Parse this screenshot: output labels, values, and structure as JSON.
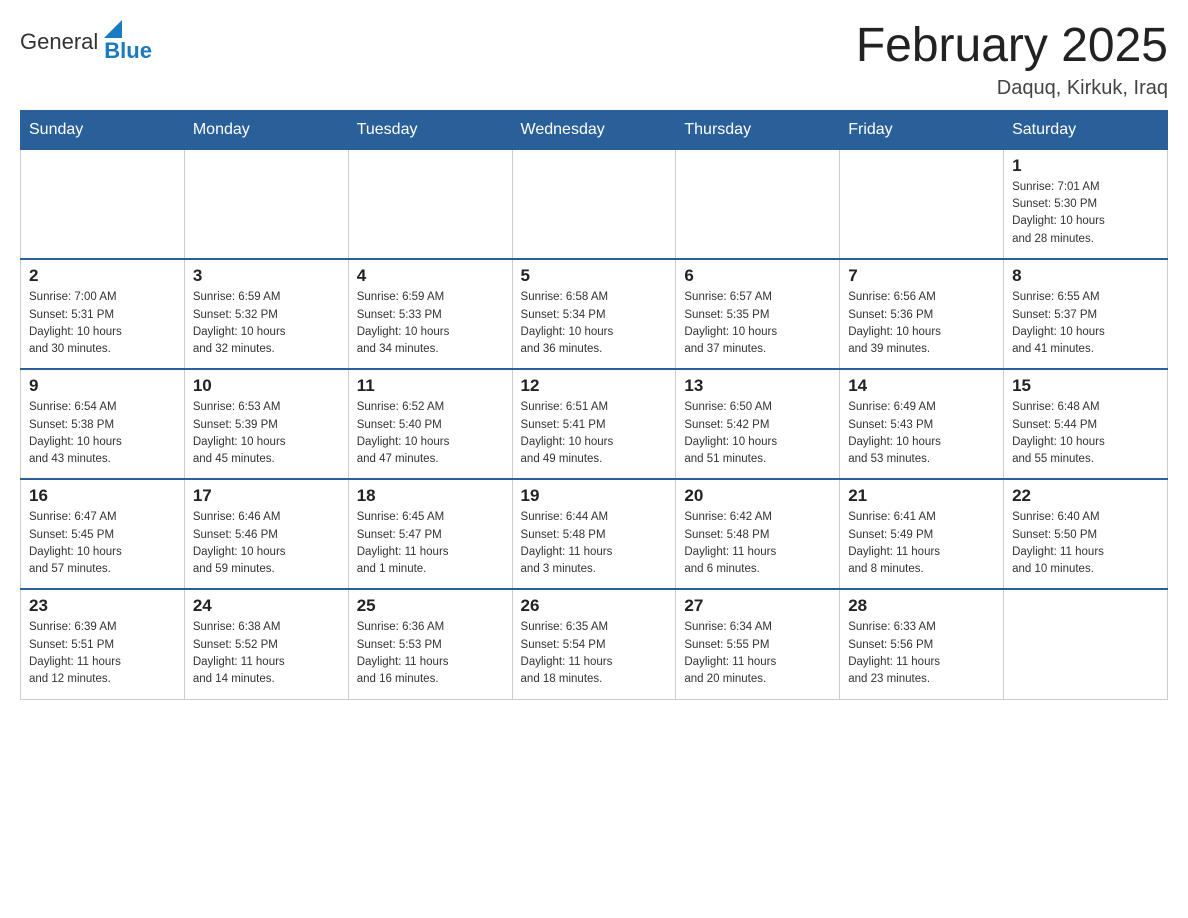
{
  "header": {
    "logo": {
      "general": "General",
      "blue": "Blue"
    },
    "title": "February 2025",
    "location": "Daquq, Kirkuk, Iraq"
  },
  "days_of_week": [
    "Sunday",
    "Monday",
    "Tuesday",
    "Wednesday",
    "Thursday",
    "Friday",
    "Saturday"
  ],
  "weeks": [
    [
      {
        "day": "",
        "info": ""
      },
      {
        "day": "",
        "info": ""
      },
      {
        "day": "",
        "info": ""
      },
      {
        "day": "",
        "info": ""
      },
      {
        "day": "",
        "info": ""
      },
      {
        "day": "",
        "info": ""
      },
      {
        "day": "1",
        "info": "Sunrise: 7:01 AM\nSunset: 5:30 PM\nDaylight: 10 hours\nand 28 minutes."
      }
    ],
    [
      {
        "day": "2",
        "info": "Sunrise: 7:00 AM\nSunset: 5:31 PM\nDaylight: 10 hours\nand 30 minutes."
      },
      {
        "day": "3",
        "info": "Sunrise: 6:59 AM\nSunset: 5:32 PM\nDaylight: 10 hours\nand 32 minutes."
      },
      {
        "day": "4",
        "info": "Sunrise: 6:59 AM\nSunset: 5:33 PM\nDaylight: 10 hours\nand 34 minutes."
      },
      {
        "day": "5",
        "info": "Sunrise: 6:58 AM\nSunset: 5:34 PM\nDaylight: 10 hours\nand 36 minutes."
      },
      {
        "day": "6",
        "info": "Sunrise: 6:57 AM\nSunset: 5:35 PM\nDaylight: 10 hours\nand 37 minutes."
      },
      {
        "day": "7",
        "info": "Sunrise: 6:56 AM\nSunset: 5:36 PM\nDaylight: 10 hours\nand 39 minutes."
      },
      {
        "day": "8",
        "info": "Sunrise: 6:55 AM\nSunset: 5:37 PM\nDaylight: 10 hours\nand 41 minutes."
      }
    ],
    [
      {
        "day": "9",
        "info": "Sunrise: 6:54 AM\nSunset: 5:38 PM\nDaylight: 10 hours\nand 43 minutes."
      },
      {
        "day": "10",
        "info": "Sunrise: 6:53 AM\nSunset: 5:39 PM\nDaylight: 10 hours\nand 45 minutes."
      },
      {
        "day": "11",
        "info": "Sunrise: 6:52 AM\nSunset: 5:40 PM\nDaylight: 10 hours\nand 47 minutes."
      },
      {
        "day": "12",
        "info": "Sunrise: 6:51 AM\nSunset: 5:41 PM\nDaylight: 10 hours\nand 49 minutes."
      },
      {
        "day": "13",
        "info": "Sunrise: 6:50 AM\nSunset: 5:42 PM\nDaylight: 10 hours\nand 51 minutes."
      },
      {
        "day": "14",
        "info": "Sunrise: 6:49 AM\nSunset: 5:43 PM\nDaylight: 10 hours\nand 53 minutes."
      },
      {
        "day": "15",
        "info": "Sunrise: 6:48 AM\nSunset: 5:44 PM\nDaylight: 10 hours\nand 55 minutes."
      }
    ],
    [
      {
        "day": "16",
        "info": "Sunrise: 6:47 AM\nSunset: 5:45 PM\nDaylight: 10 hours\nand 57 minutes."
      },
      {
        "day": "17",
        "info": "Sunrise: 6:46 AM\nSunset: 5:46 PM\nDaylight: 10 hours\nand 59 minutes."
      },
      {
        "day": "18",
        "info": "Sunrise: 6:45 AM\nSunset: 5:47 PM\nDaylight: 11 hours\nand 1 minute."
      },
      {
        "day": "19",
        "info": "Sunrise: 6:44 AM\nSunset: 5:48 PM\nDaylight: 11 hours\nand 3 minutes."
      },
      {
        "day": "20",
        "info": "Sunrise: 6:42 AM\nSunset: 5:48 PM\nDaylight: 11 hours\nand 6 minutes."
      },
      {
        "day": "21",
        "info": "Sunrise: 6:41 AM\nSunset: 5:49 PM\nDaylight: 11 hours\nand 8 minutes."
      },
      {
        "day": "22",
        "info": "Sunrise: 6:40 AM\nSunset: 5:50 PM\nDaylight: 11 hours\nand 10 minutes."
      }
    ],
    [
      {
        "day": "23",
        "info": "Sunrise: 6:39 AM\nSunset: 5:51 PM\nDaylight: 11 hours\nand 12 minutes."
      },
      {
        "day": "24",
        "info": "Sunrise: 6:38 AM\nSunset: 5:52 PM\nDaylight: 11 hours\nand 14 minutes."
      },
      {
        "day": "25",
        "info": "Sunrise: 6:36 AM\nSunset: 5:53 PM\nDaylight: 11 hours\nand 16 minutes."
      },
      {
        "day": "26",
        "info": "Sunrise: 6:35 AM\nSunset: 5:54 PM\nDaylight: 11 hours\nand 18 minutes."
      },
      {
        "day": "27",
        "info": "Sunrise: 6:34 AM\nSunset: 5:55 PM\nDaylight: 11 hours\nand 20 minutes."
      },
      {
        "day": "28",
        "info": "Sunrise: 6:33 AM\nSunset: 5:56 PM\nDaylight: 11 hours\nand 23 minutes."
      },
      {
        "day": "",
        "info": ""
      }
    ]
  ]
}
